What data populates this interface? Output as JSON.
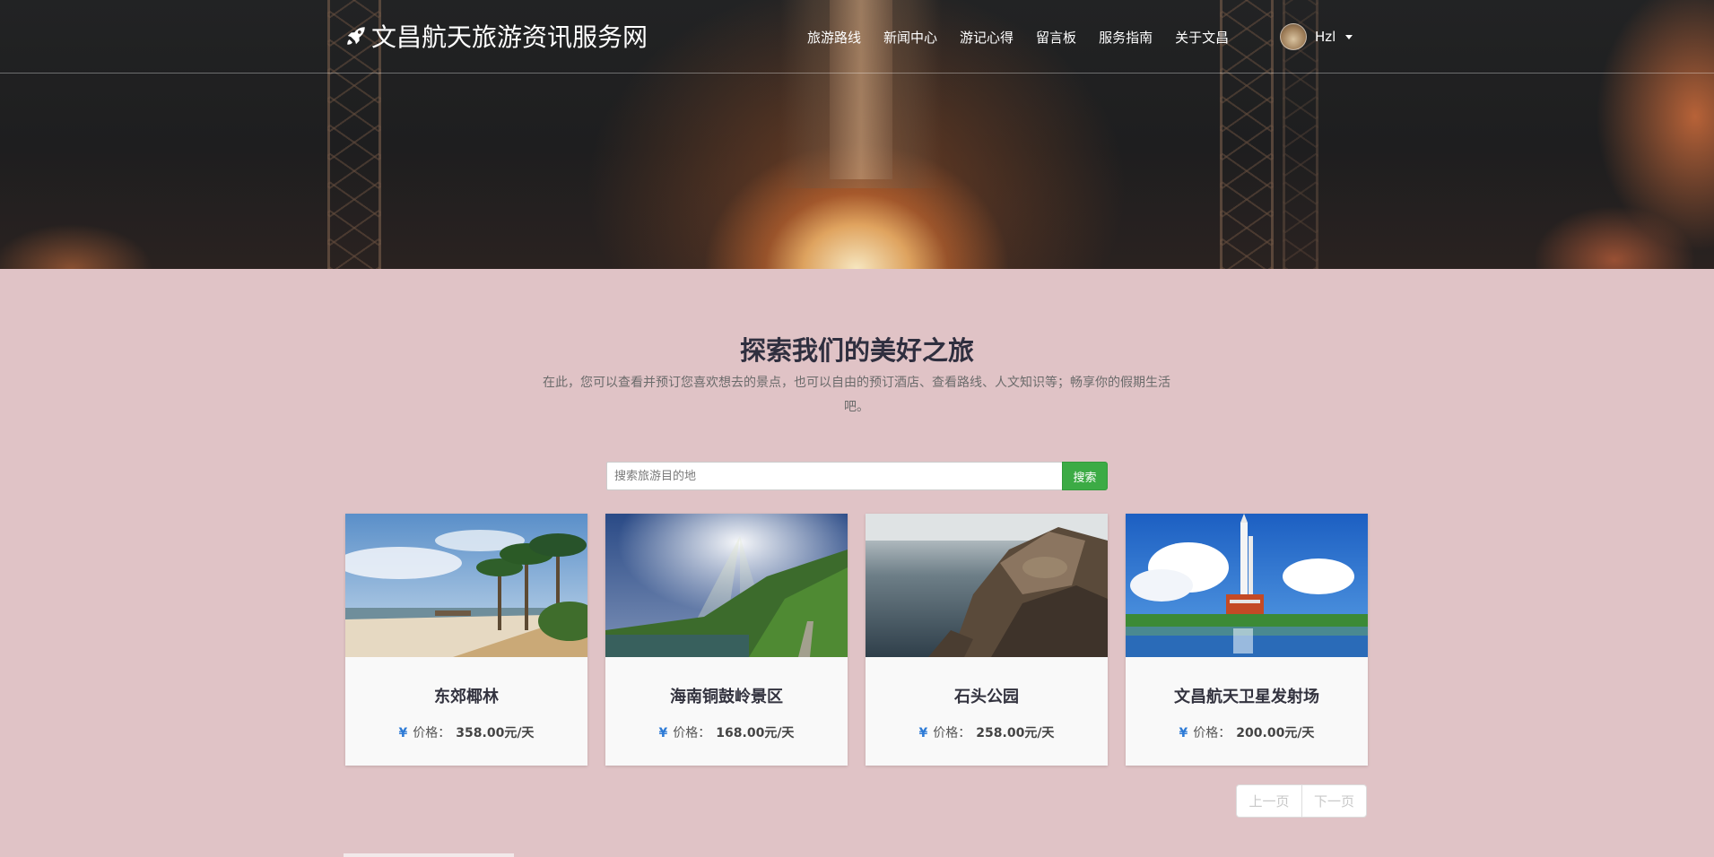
{
  "navbar": {
    "brand": "文昌航天旅游资讯服务网",
    "brand_icon": "rocket-icon",
    "links": [
      "旅游路线",
      "新闻中心",
      "游记心得",
      "留言板",
      "服务指南",
      "关于文昌"
    ],
    "user_name": "Hzl"
  },
  "section": {
    "title": "探索我们的美好之旅",
    "description": "在此，您可以查看并预订您喜欢想去的景点，也可以自由的预订酒店、查看路线、人文知识等；畅享你的假期生活吧。"
  },
  "search": {
    "placeholder": "搜索旅游目的地",
    "button_label": "搜索"
  },
  "cards": [
    {
      "title": "东郊椰林",
      "price_label": "价格：",
      "price": "358.00元/天",
      "currency_icon": "yen-icon"
    },
    {
      "title": "海南铜鼓岭景区",
      "price_label": "价格：",
      "price": "168.00元/天",
      "currency_icon": "yen-icon"
    },
    {
      "title": "石头公园",
      "price_label": "价格：",
      "price": "258.00元/天",
      "currency_icon": "yen-icon"
    },
    {
      "title": "文昌航天卫星发射场",
      "price_label": "价格：",
      "price": "200.00元/天",
      "currency_icon": "yen-icon"
    }
  ],
  "pager": {
    "prev_label": "上一页",
    "next_label": "下一页"
  },
  "colors": {
    "page_background": "#e0c3c6",
    "search_button": "#3cab45",
    "currency_accent": "#2e7bd6"
  }
}
